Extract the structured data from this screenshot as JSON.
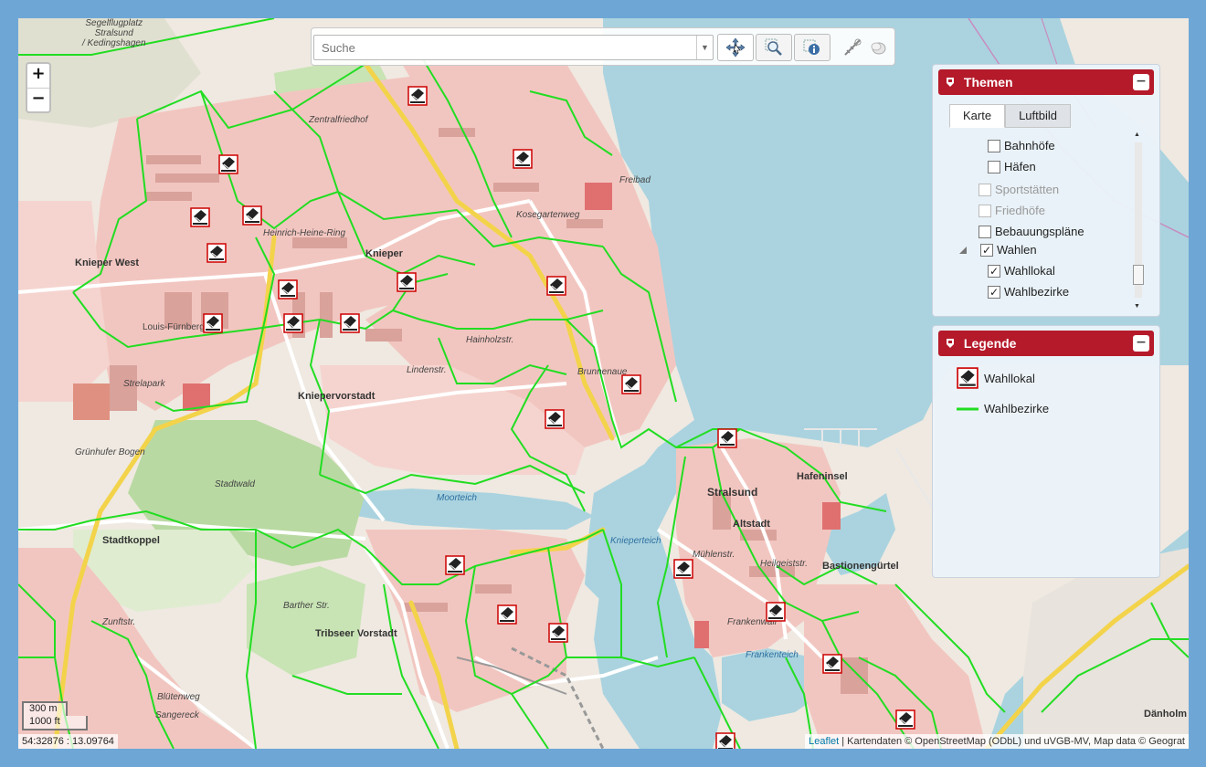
{
  "map": {
    "zoom_in": "+",
    "zoom_out": "−",
    "coords": "54:32876 : 13.09764",
    "scale_metric": "300 m",
    "scale_imperial": "1000 ft",
    "attribution_link": "Leaflet",
    "attribution_text": " | Kartendaten © OpenStreetMap (ODbL) und uVGB-MV, Map data © Geograt",
    "labels": [
      "Segelflugplatz\nStralsund\n/ Kedingshagen",
      "Zentralfriedhof",
      "Knieper West",
      "Knieper",
      "Louis-Fürnberg",
      "Strelapark",
      "Stadtwald",
      "Stadtkoppel",
      "Tribseer Vorstadt",
      "Kniepervorstadt",
      "Moorteich",
      "Knieperteich",
      "Frankenteich",
      "Stralsund",
      "Altstadt",
      "Hafeninsel",
      "Bastionengürtel",
      "Heinrich-Heine-Ring",
      "Lindenstr.",
      "Hainholzstr.",
      "Barther Str.",
      "Grünhufer Bogen",
      "Frankenwall",
      "Kosegartenweg",
      "Sangereck",
      "Blütenweg",
      "Zunftstr.",
      "Dänholm",
      "Brunnenaue",
      "Heilgeiststr.",
      "Mühlenstr.",
      "Freibad"
    ]
  },
  "toolbar": {
    "search_placeholder": "Suche",
    "tools": [
      "pan-icon",
      "zoom-box-icon",
      "info-icon",
      "measure-icon",
      "clear-icon"
    ]
  },
  "themen": {
    "title": "Themen",
    "minimize": "−",
    "tabs": [
      {
        "label": "Karte",
        "active": true
      },
      {
        "label": "Luftbild",
        "active": false
      }
    ],
    "items": [
      {
        "label": "Bahnhöfe",
        "checked": false,
        "enabled": true
      },
      {
        "label": "Häfen",
        "checked": false,
        "enabled": true
      },
      {
        "label": "Sportstätten",
        "checked": false,
        "enabled": false
      },
      {
        "label": "Friedhöfe",
        "checked": false,
        "enabled": false
      },
      {
        "label": "Bebauungspläne",
        "checked": false,
        "enabled": true
      },
      {
        "label": "Wahlen",
        "checked": true,
        "enabled": true
      },
      {
        "label": "Wahllokal",
        "checked": true,
        "enabled": true
      },
      {
        "label": "Wahlbezirke",
        "checked": true,
        "enabled": true
      }
    ]
  },
  "legende": {
    "title": "Legende",
    "minimize": "−",
    "items": [
      {
        "label": "Wahllokal",
        "symbol": "ballot-box-icon"
      },
      {
        "label": "Wahlbezirke",
        "symbol": "green-line",
        "color": "#22dd22"
      }
    ]
  },
  "colors": {
    "water": "#aad3df",
    "land": "#efe9e1",
    "residential": "#f2c6c0",
    "park": "#c8e3b4",
    "district_line": "#22dd22",
    "header_red": "#b51a2a",
    "frame": "#6ea7d6"
  }
}
